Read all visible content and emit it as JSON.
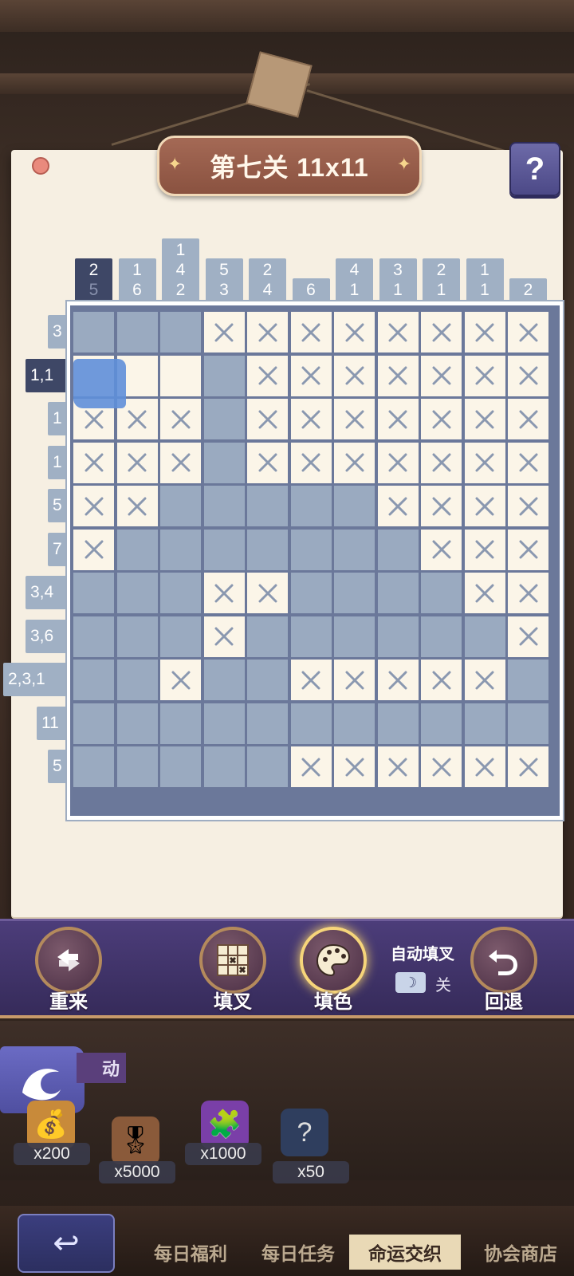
{
  "level": {
    "title": "第七关 11x11"
  },
  "help": {
    "label": "?"
  },
  "puzzle": {
    "col_clues": [
      [
        "2",
        "5"
      ],
      [
        "1",
        "6"
      ],
      [
        "1",
        "4",
        "2"
      ],
      [
        "5",
        "3"
      ],
      [
        "2",
        "4"
      ],
      [
        "6"
      ],
      [
        "4",
        "1"
      ],
      [
        "3",
        "1"
      ],
      [
        "2",
        "1"
      ],
      [
        "1",
        "1"
      ],
      [
        "2"
      ]
    ],
    "row_clues": [
      "3",
      "1,1",
      "1",
      "1",
      "5",
      "7",
      "3,4",
      "3,6",
      "2,3,1",
      "11",
      "5"
    ],
    "grid": [
      "FFFXXXXXXXX",
      "EEEFXXXXXXX",
      "XXXFXXXXXXX",
      "XXXFXXXXXXX",
      "XXFFFFFXXXX",
      "XFFFFFFFXXX",
      "FFFXXFFFFXX",
      "FFFXFFFFFFX",
      "FFXFFXXXXXF",
      "FFFFFFFFFFF",
      "FFFFFXXXXXX"
    ]
  },
  "toolbar": {
    "restart_label": "重来",
    "fill_cross_label": "填叉",
    "fill_color_label": "填色",
    "auto_cross_label": "自动填叉",
    "auto_cross_state": "关",
    "undo_label": "回退"
  },
  "rewards": {
    "banner_text": "动",
    "items": [
      {
        "count": "x200"
      },
      {
        "count": "x5000"
      },
      {
        "count": "x1000"
      },
      {
        "count": "x50"
      }
    ]
  },
  "nav": {
    "tabs": [
      "每日福利",
      "每日任务",
      "命运交织",
      "协会商店"
    ],
    "active_index": 2
  },
  "colors": {
    "filled": "#9aaac0",
    "board_bg": "#6b789a",
    "active_clue": "#3e4766",
    "cross": "#8a98b0"
  }
}
